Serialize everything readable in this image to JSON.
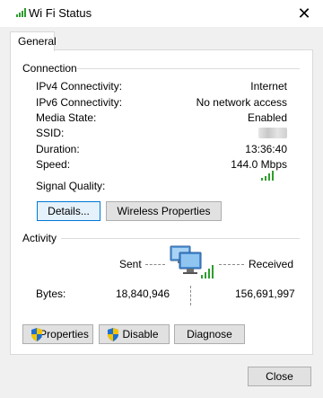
{
  "window": {
    "title": "Wi Fi Status",
    "close_glyph": "✕"
  },
  "tabs": [
    {
      "label": "General"
    }
  ],
  "connection": {
    "section_label": "Connection",
    "rows": [
      {
        "label": "IPv4 Connectivity:",
        "value": "Internet"
      },
      {
        "label": "IPv6 Connectivity:",
        "value": "No network access"
      },
      {
        "label": "Media State:",
        "value": "Enabled"
      },
      {
        "label": "SSID:",
        "value": ""
      },
      {
        "label": "Duration:",
        "value": "13:36:40"
      },
      {
        "label": "Speed:",
        "value": "144.0 Mbps"
      }
    ],
    "signal_quality_label": "Signal Quality:",
    "signal_bars_active": 4,
    "signal_bars_total": 4
  },
  "buttons_top": {
    "details": "Details...",
    "wireless_properties": "Wireless Properties"
  },
  "activity": {
    "section_label": "Activity",
    "sent_label": "Sent",
    "received_label": "Received",
    "bytes_label": "Bytes:",
    "bytes_sent": "18,840,946",
    "bytes_received": "156,691,997"
  },
  "buttons_bottom": {
    "properties": "Properties",
    "disable": "Disable",
    "diagnose": "Diagnose"
  },
  "footer": {
    "close": "Close"
  },
  "colors": {
    "accent_border": "#0078d7",
    "signal_green": "#2e9d2e",
    "button_face": "#e1e1e1"
  }
}
